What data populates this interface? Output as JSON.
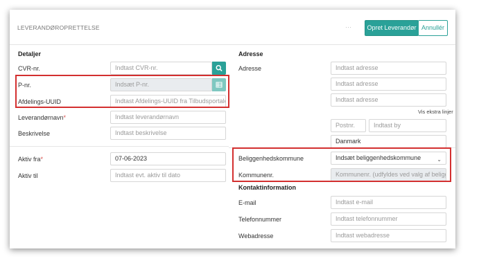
{
  "header": {
    "title": "LEVERANDØROPRETTELSE",
    "more_label": "···",
    "create_button": "Opret Leverandør",
    "cancel_button": "Annullér"
  },
  "details": {
    "section_title": "Detaljer",
    "cvr": {
      "label": "CVR-nr.",
      "placeholder": "Indtast CVR-nr."
    },
    "pnr": {
      "label": "P-nr.",
      "placeholder": "Indsæt P-nr."
    },
    "uuid": {
      "label": "Afdelings-UUID",
      "placeholder": "Indtast Afdelings-UUID fra Tilbudsportalen"
    },
    "name": {
      "label": "Leverandørnavn",
      "required_mark": "*",
      "placeholder": "Indtast leverandørnavn"
    },
    "description": {
      "label": "Beskrivelse",
      "placeholder": "Indtast beskrivelse"
    },
    "active_from": {
      "label": "Aktiv fra",
      "required_mark": "*",
      "value": "07-06-2023"
    },
    "active_to": {
      "label": "Aktiv til",
      "placeholder": "Indtast evt. aktiv til dato"
    }
  },
  "address": {
    "section_title": "Adresse",
    "label": "Adresse",
    "line1_placeholder": "Indtast adresse",
    "line2_placeholder": "Indtast adresse",
    "line3_placeholder": "Indtast adresse",
    "more_lines_link": "Vis ekstra linjer",
    "postal_placeholder": "Postnr.",
    "city_placeholder": "Indtast by",
    "country_value": "Danmark",
    "municipality": {
      "label": "Beliggenhedskommune",
      "selected": "Indsæt beliggenhedskommune"
    },
    "municipality_no": {
      "label": "Kommunenr.",
      "placeholder": "Kommunenr. (udfyldes ved valg af beliggenh"
    }
  },
  "contact": {
    "section_title": "Kontaktinformation",
    "email": {
      "label": "E-mail",
      "placeholder": "Indtast e-mail"
    },
    "phone": {
      "label": "Telefonnummer",
      "placeholder": "Indtast telefonnummer"
    },
    "web": {
      "label": "Webadresse",
      "placeholder": "Indtast webadresse"
    }
  },
  "colors": {
    "accent": "#2aa198",
    "highlight": "#d32f2f"
  }
}
